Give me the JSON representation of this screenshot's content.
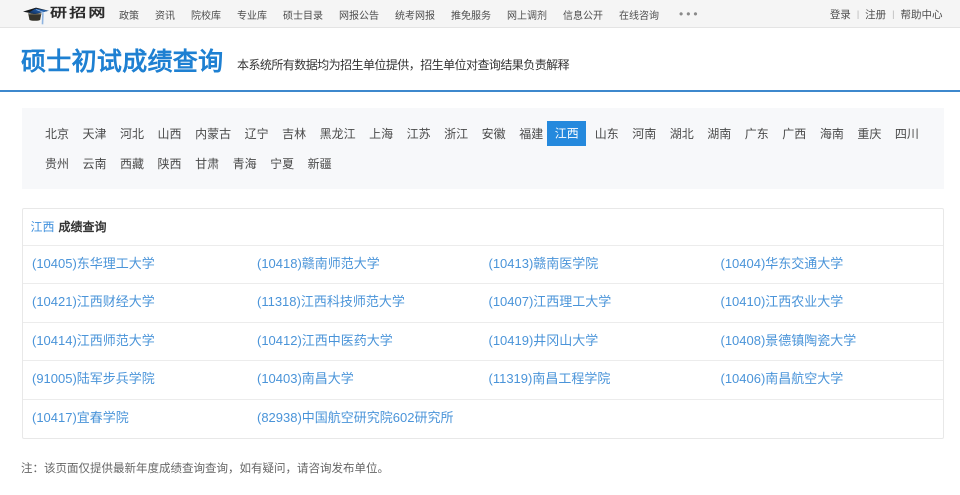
{
  "topbar": {
    "logo_text": "研招网",
    "nav_items": [
      "政策",
      "资讯",
      "院校库",
      "专业库",
      "硕士目录",
      "网报公告",
      "统考网报",
      "推免服务",
      "网上调剂",
      "信息公开",
      "在线咨询"
    ],
    "nav_more": "•••",
    "account_items": [
      "登录",
      "注册",
      "帮助中心"
    ],
    "account_separator": "|"
  },
  "titlebar": {
    "title": "硕士初试成绩查询",
    "subtitle": "本系统所有数据均为招生单位提供，招生单位对查询结果负责解释"
  },
  "province_selector": {
    "provinces": [
      "北京",
      "天津",
      "河北",
      "山西",
      "内蒙古",
      "辽宁",
      "吉林",
      "黑龙江",
      "上海",
      "江苏",
      "浙江",
      "安徽",
      "福建",
      "江西",
      "山东",
      "河南",
      "湖北",
      "湖南",
      "广东",
      "广西",
      "海南",
      "重庆",
      "四川",
      "贵州",
      "云南",
      "西藏",
      "陕西",
      "甘肃",
      "青海",
      "宁夏",
      "新疆"
    ],
    "selected": "江西"
  },
  "results": {
    "region": "江西",
    "caption": "成绩查询",
    "rows": [
      [
        "(10405)东华理工大学",
        "(10418)赣南师范大学",
        "(10413)赣南医学院",
        "(10404)华东交通大学"
      ],
      [
        "(10421)江西财经大学",
        "(11318)江西科技师范大学",
        "(10407)江西理工大学",
        "(10410)江西农业大学"
      ],
      [
        "(10414)江西师范大学",
        "(10412)江西中医药大学",
        "(10419)井冈山大学",
        "(10408)景德镇陶瓷大学"
      ],
      [
        "(91005)陆军步兵学院",
        "(10403)南昌大学",
        "(11319)南昌工程学院",
        "(10406)南昌航空大学"
      ],
      [
        "(10417)宜春学院",
        "(82938)中国航空研究院602研究所",
        "",
        ""
      ]
    ]
  },
  "note": "注：该页面仅提供最新年度成绩查询查询，如有疑问，请咨询发布单位。",
  "colors": {
    "title_blue": "#1e80d2",
    "underline_blue": "#3e88cd",
    "selected_badge_blue": "#2589dd",
    "link_blue": "#4a94d9",
    "topbar_bg": "#f5f5f5",
    "panel_bg": "#f7f8fa"
  }
}
